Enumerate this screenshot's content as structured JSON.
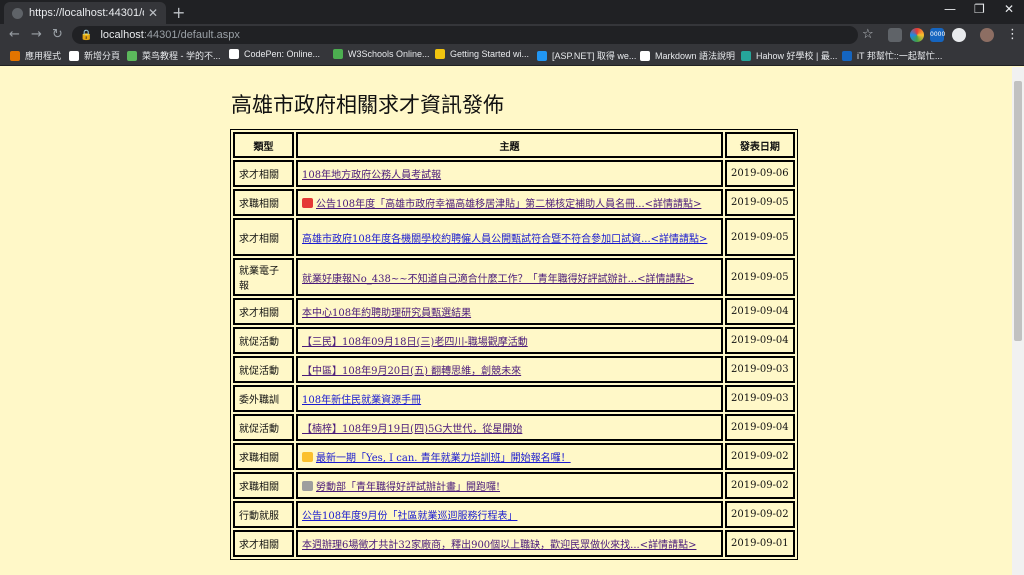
{
  "browser": {
    "tab_title": "https://localhost:44301/default",
    "url_host": "localhost",
    "url_path": ":44301/default.aspx",
    "bookmarks": [
      {
        "label": "應用程式",
        "color": "#e37400"
      },
      {
        "label": "新增分頁",
        "color": "#ffffff"
      },
      {
        "label": "菜鸟教程 - 学的不...",
        "color": "#5cb85c"
      },
      {
        "label": "CodePen: Online...",
        "color": "#ffffff"
      },
      {
        "label": "W3Schools Online...",
        "color": "#4caf50"
      },
      {
        "label": "Getting Started wi...",
        "color": "#f1c40f"
      },
      {
        "label": "[ASP.NET] 取得 we...",
        "color": "#2196f3"
      },
      {
        "label": "Markdown 語法說明",
        "color": "#ffffff"
      },
      {
        "label": "Hahow 好學校 | 最...",
        "color": "#26a69a"
      },
      {
        "label": "iT 邦幫忙::一起幫忙...",
        "color": "#1565c0"
      }
    ],
    "extension_badge": "0000"
  },
  "page": {
    "title": "高雄市政府相關求才資訊發佈",
    "headers": {
      "category": "類型",
      "topic": "主題",
      "date": "發表日期"
    },
    "rows": [
      {
        "category": "求才相關",
        "topic": "108年地方政府公務人員考試報",
        "date": "2019-09-06",
        "visited": true,
        "tall": false,
        "emoji": ""
      },
      {
        "category": "求職相關",
        "topic": "公告108年度「高雄市政府幸福高雄移居津貼」第二梯核定補助人員名冊...<詳情請點>",
        "date": "2019-09-05",
        "visited": true,
        "tall": false,
        "emoji": "#e53935"
      },
      {
        "category": "求才相關",
        "topic": "高雄市政府108年度各機關學校約聘僱人員公開甄試符合暨不符合參加口試資...<詳情請點>",
        "date": "2019-09-05",
        "visited": false,
        "tall": true,
        "emoji": ""
      },
      {
        "category": "就業電子報",
        "topic": "就業好康報No_438~~不知道自己適合什麼工作？「青年職得好評試辦計...<詳情請點>",
        "date": "2019-09-05",
        "visited": true,
        "tall": true,
        "emoji": ""
      },
      {
        "category": "求才相關",
        "topic": "本中心108年約聘助理研究員甄選結果",
        "date": "2019-09-04",
        "visited": true,
        "tall": false,
        "emoji": ""
      },
      {
        "category": "就促活動",
        "topic": "【三民】108年09月18日(三)老四川-職場觀摩活動",
        "date": "2019-09-04",
        "visited": true,
        "tall": false,
        "emoji": ""
      },
      {
        "category": "就促活動",
        "topic": "【中區】108年9月20日(五) 翻轉思維，創競未來",
        "date": "2019-09-03",
        "visited": true,
        "tall": false,
        "emoji": ""
      },
      {
        "category": "委外職訓",
        "topic": "108年新住民就業資源手冊",
        "date": "2019-09-03",
        "visited": false,
        "tall": false,
        "emoji": ""
      },
      {
        "category": "就促活動",
        "topic": "【楠梓】108年9月19日(四)5G大世代，從星開始",
        "date": "2019-09-04",
        "visited": true,
        "tall": false,
        "emoji": ""
      },
      {
        "category": "求職相關",
        "topic": "最新一期「Yes, I can. 青年就業力培訓班」開始報名囉！",
        "date": "2019-09-02",
        "visited": false,
        "tall": false,
        "emoji": "#fbc02d"
      },
      {
        "category": "求職相關",
        "topic": "勞動部「青年職得好評試辦計畫」開跑囉!",
        "date": "2019-09-02",
        "visited": true,
        "tall": false,
        "emoji": "#9e9e9e"
      },
      {
        "category": "行動就服",
        "topic": "公告108年度9月份「社區就業巡迴服務行程表」",
        "date": "2019-09-02",
        "visited": false,
        "tall": false,
        "emoji": ""
      },
      {
        "category": "求才相關",
        "topic": "本週辦理6場徵才共計32家廠商，釋出900個以上職缺，歡迎民眾做伙來找...<詳情請點>",
        "date": "2019-09-01",
        "visited": true,
        "tall": false,
        "emoji": ""
      }
    ]
  }
}
